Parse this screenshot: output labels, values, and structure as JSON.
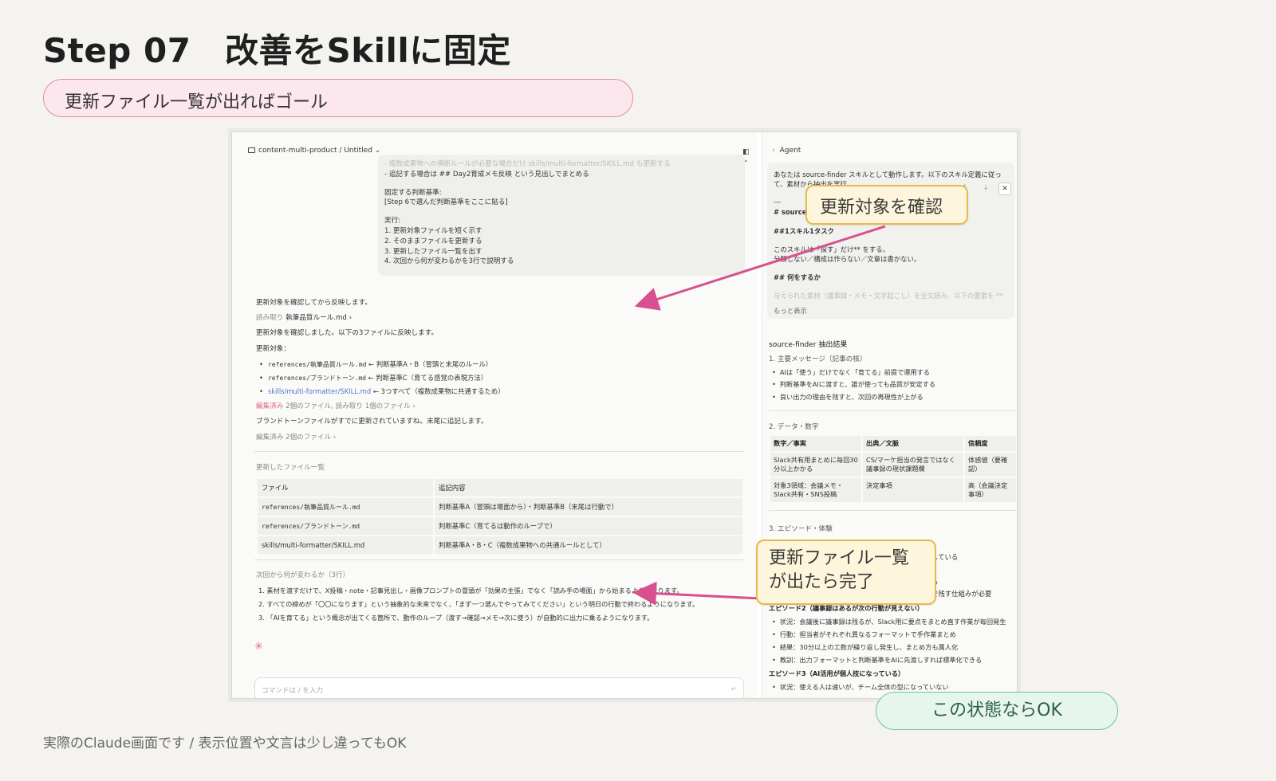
{
  "slide": {
    "title": "Step 07　改善をSkillに固定",
    "goal": "更新ファイル一覧が出ればゴール",
    "footer": "実際のClaude画面です / 表示位置や文言は少し違ってもOK",
    "ok_badge": "この状態ならOK"
  },
  "callouts": {
    "confirm": "更新対象を確認",
    "done_line1": "更新ファイル一覧",
    "done_line2": "が出たら完了"
  },
  "window": {
    "breadcrumb": "content-multi-product / Untitled ⌄",
    "panel_toggle": "◧ ⌄"
  },
  "prompt": {
    "faded_line": "- 複数成果物への横断ルールが必要な場合だけ skills/multi-formatter/SKILL.md も更新する",
    "lines": [
      "- 追記する場合は ## Day2育成メモ反映 という見出しでまとめる",
      "",
      "固定する判断基準:",
      "[Step 6で選んだ判断基準をここに貼る]",
      "",
      "実行:",
      "1. 更新対象ファイルを短く示す",
      "2. そのままファイルを更新する",
      "3. 更新したファイル一覧を出す",
      "4. 次回から何が変わるかを3行で説明する"
    ]
  },
  "chat": {
    "reflect": "更新対象を確認してから反映します。",
    "read_label": "読み取り",
    "read_file": "執筆品質ルール.md ›",
    "confirmed": "更新対象を確認しました。以下の3ファイルに反映します。",
    "targets_label": "更新対象：",
    "targets": [
      {
        "file": "references/執筆品質ルール.md",
        "note": " ← 判断基準A・B（冒頭と末尾のルール）"
      },
      {
        "file": "references/ブランドトーン.md",
        "note": " ← 判断基準C（育てる感覚の表現方法）"
      },
      {
        "file": "skills/multi-formatter/SKILL.md",
        "note": " ← 3つすべて（複数成果物に共通するため）"
      }
    ],
    "edited_label": "編集済み",
    "edited_detail": "2個のファイル, 読み取り 1個のファイル ›",
    "brand_note": "ブランドトーンファイルがすでに更新されていますね。末尾に追記します。",
    "edited2": "編集済み 2個のファイル ›",
    "updated_title": "更新したファイル一覧",
    "table_headers": [
      "ファイル",
      "追記内容"
    ],
    "table_rows": [
      [
        "references/執筆品質ルール.md",
        "判断基準A（冒頭は場面から）・判断基準B（末尾は行動で）"
      ],
      [
        "references/ブランドトーン.md",
        "判断基準C（育てるは動作のループで）"
      ],
      [
        "skills/multi-formatter/SKILL.md",
        "判断基準A・B・C（複数成果物への共通ルールとして）"
      ]
    ],
    "next_title": "次回から何が変わるか（3行）",
    "next_items": [
      "1. 素材を渡すだけで、X投稿・note・記事見出し・画像プロンプトの冒頭が「効果の主張」でなく「読み手の場面」から始まるようになります。",
      "2. すべての締めが「〇〇になります」という抽象的な未来でなく、「まず一つ選んでやってみてください」という明日の行動で終わるようになります。",
      "3. 「AIを育てる」という概念が出てくる箇所で、動作のループ（渡す→確認→メモ→次に使う）が自動的に出力に乗るようになります。"
    ],
    "spark": "✳",
    "command_placeholder": "コマンドは / を入力",
    "send_icon": "↵"
  },
  "agent": {
    "title": "Agent",
    "intro_1": "あなたは source-finder スキルとして動作します。以下のスキル定義に従っ",
    "intro_2": "て、素材から抽出を実行",
    "dashes": "---",
    "heading_1": "# source",
    "heading_2": "##1スキル1タスク",
    "body_1": "このスキルは「探す」だけ** をする。",
    "body_2": "分類しない／構成は作らない／文章は書かない。",
    "heading_3": "## 何をするか",
    "faded": "与えられた素材（議事録・メモ・文字起こし）を全文読み、以下の要素を **",
    "more": "もっと表示",
    "result_title": "source-finder 抽出結果",
    "sec1": "1. 主要メッセージ（記事の核）",
    "sec1_items": [
      "AIは「使う」だけでなく「育てる」前提で運用する",
      "判断基準をAIに渡すと、誰が使っても品質が安定する",
      "良い出力の理由を残すと、次回の再現性が上がる"
    ],
    "sec2": "2. データ・数字",
    "data_headers": [
      "数字／事実",
      "出典／文脈",
      "信頼度"
    ],
    "data_rows": [
      [
        "Slack共有用まとめに毎回30分以上かかる",
        "CS/マーケ担当の発言ではなく議事録の現状課題欄",
        "体感値（要確認）"
      ],
      [
        "対象3領域：会議メモ・Slack共有・SNS投稿",
        "決定事項",
        "高（会議決定事項）"
      ]
    ],
    "sec3": "3. エピソード・体験",
    "partial_1": "している",
    "partial_2": "る",
    "partial_3": "で残す仕組みが必要",
    "ep2": "エピソード2（議事録はあるが次の行動が見えない）",
    "ep2_items": [
      "状況：会議後に議事録は残るが、Slack用に要点をまとめ直す作業が毎回発生",
      "行動：担当者がそれぞれ異なるフォーマットで手作業まとめ",
      "結果：30分以上の工数が繰り返し発生し、まとめ方も属人化",
      "教訓：出力フォーマットと判断基準をAIに先渡しすれば標準化できる"
    ],
    "ep3": "エピソード3（AI活用が個人技になっている）",
    "ep3_items": [
      "状況：使える人は速いが、チーム全体の型になっていない"
    ],
    "ctrl": "↑ ↓",
    "close": "✕"
  },
  "colors": {
    "accent_pink": "#d94f8f",
    "goal_bg": "#fde7ef",
    "ok_bg": "#e6f6ee",
    "callout_bg": "#fdf6dc",
    "callout_border": "#e8b94a"
  }
}
